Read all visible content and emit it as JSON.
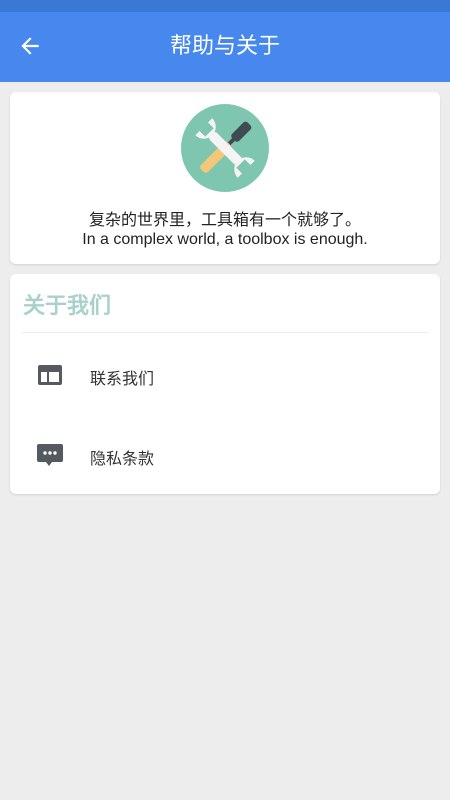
{
  "header": {
    "title": "帮助与关于",
    "back_icon": "arrow-left-icon",
    "bg_color": "#4688ee"
  },
  "intro": {
    "logo_icon": "tools-icon",
    "slogan_cn": "复杂的世界里，工具箱有一个就够了。",
    "slogan_en": "In a complex world, a toolbox is enough."
  },
  "about": {
    "title": "关于我们",
    "title_color": "#a8d1cc",
    "items": [
      {
        "label": "联系我们",
        "icon": "web-window-icon"
      },
      {
        "label": "隐私条款",
        "icon": "chat-bubble-icon"
      }
    ]
  }
}
